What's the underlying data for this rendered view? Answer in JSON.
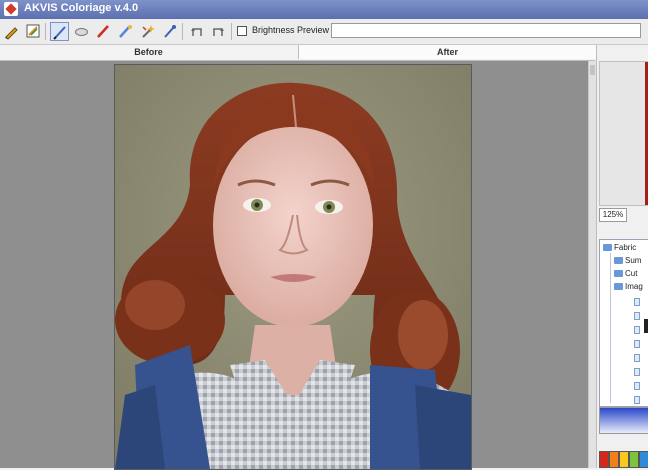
{
  "window": {
    "title": "AKVIS Coloriage v.4.0"
  },
  "toolbar": {
    "brightness_label": "Brightness Preview",
    "tools": [
      "pencil-icon",
      "layers-icon",
      "brush-icon",
      "eraser-icon",
      "red-pencil-icon",
      "color-brush-icon",
      "magic-wand-icon",
      "pipette-icon",
      "undo-icon",
      "redo-icon"
    ]
  },
  "tabs": {
    "before": "Before",
    "after": "After"
  },
  "right_panel": {
    "zoom": "125%",
    "tree": {
      "root": "Fabric",
      "children": [
        "Sum",
        "Cut",
        "Imag"
      ]
    }
  },
  "colors": {
    "swatches": [
      "#d7261c",
      "#f27f18",
      "#f9c71e",
      "#7cc43f",
      "#2f8bd8"
    ]
  }
}
